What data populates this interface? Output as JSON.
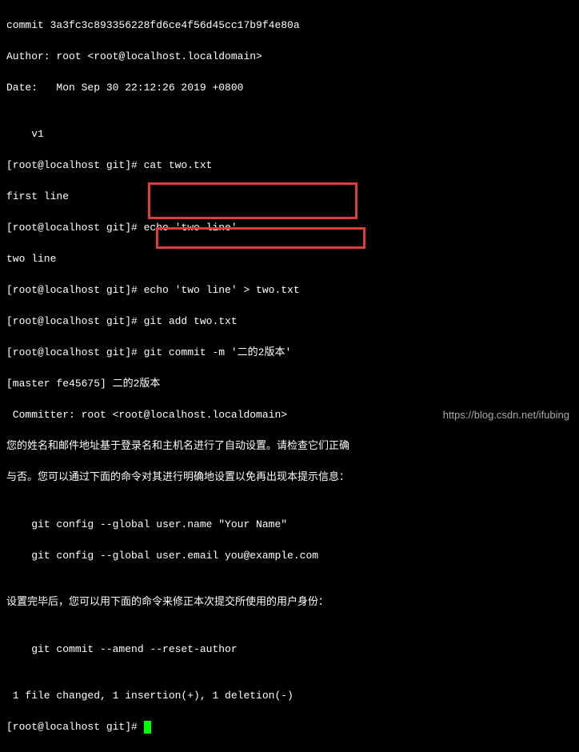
{
  "lines": {
    "l0": "commit 3a3fc3c893356228fd6ce4f56d45cc17b9f4e80a",
    "l1": "Author: root <root@localhost.localdomain>",
    "l2": "Date:   Mon Sep 30 22:12:26 2019 +0800",
    "l3": "",
    "l4": "    v1",
    "l5": "[root@localhost git]# cat two.txt",
    "l6": "first line",
    "l7": "[root@localhost git]# echo 'two line'",
    "l8": "two line",
    "l9": "[root@localhost git]# echo 'two line' > two.txt",
    "l10": "[root@localhost git]# git add two.txt",
    "l11": "[root@localhost git]# git commit -m '二的2版本'",
    "l12": "[master fe45675] 二的2版本",
    "l13": " Committer: root <root@localhost.localdomain>",
    "l14": "您的姓名和邮件地址基于登录名和主机名进行了自动设置。请检查它们正确",
    "l15": "与否。您可以通过下面的命令对其进行明确地设置以免再出现本提示信息：",
    "l16": "",
    "l17": "    git config --global user.name \"Your Name\"",
    "l18": "    git config --global user.email you@example.com",
    "l19": "",
    "l20": "设置完毕后，您可以用下面的命令来修正本次提交所使用的用户身份：",
    "l21": "",
    "l22": "    git commit --amend --reset-author",
    "l23": "",
    "l24": " 1 file changed, 1 insertion(+), 1 deletion(-)",
    "l25": "[root@localhost git]# "
  },
  "watermark": "https://blog.csdn.net/ifubing"
}
